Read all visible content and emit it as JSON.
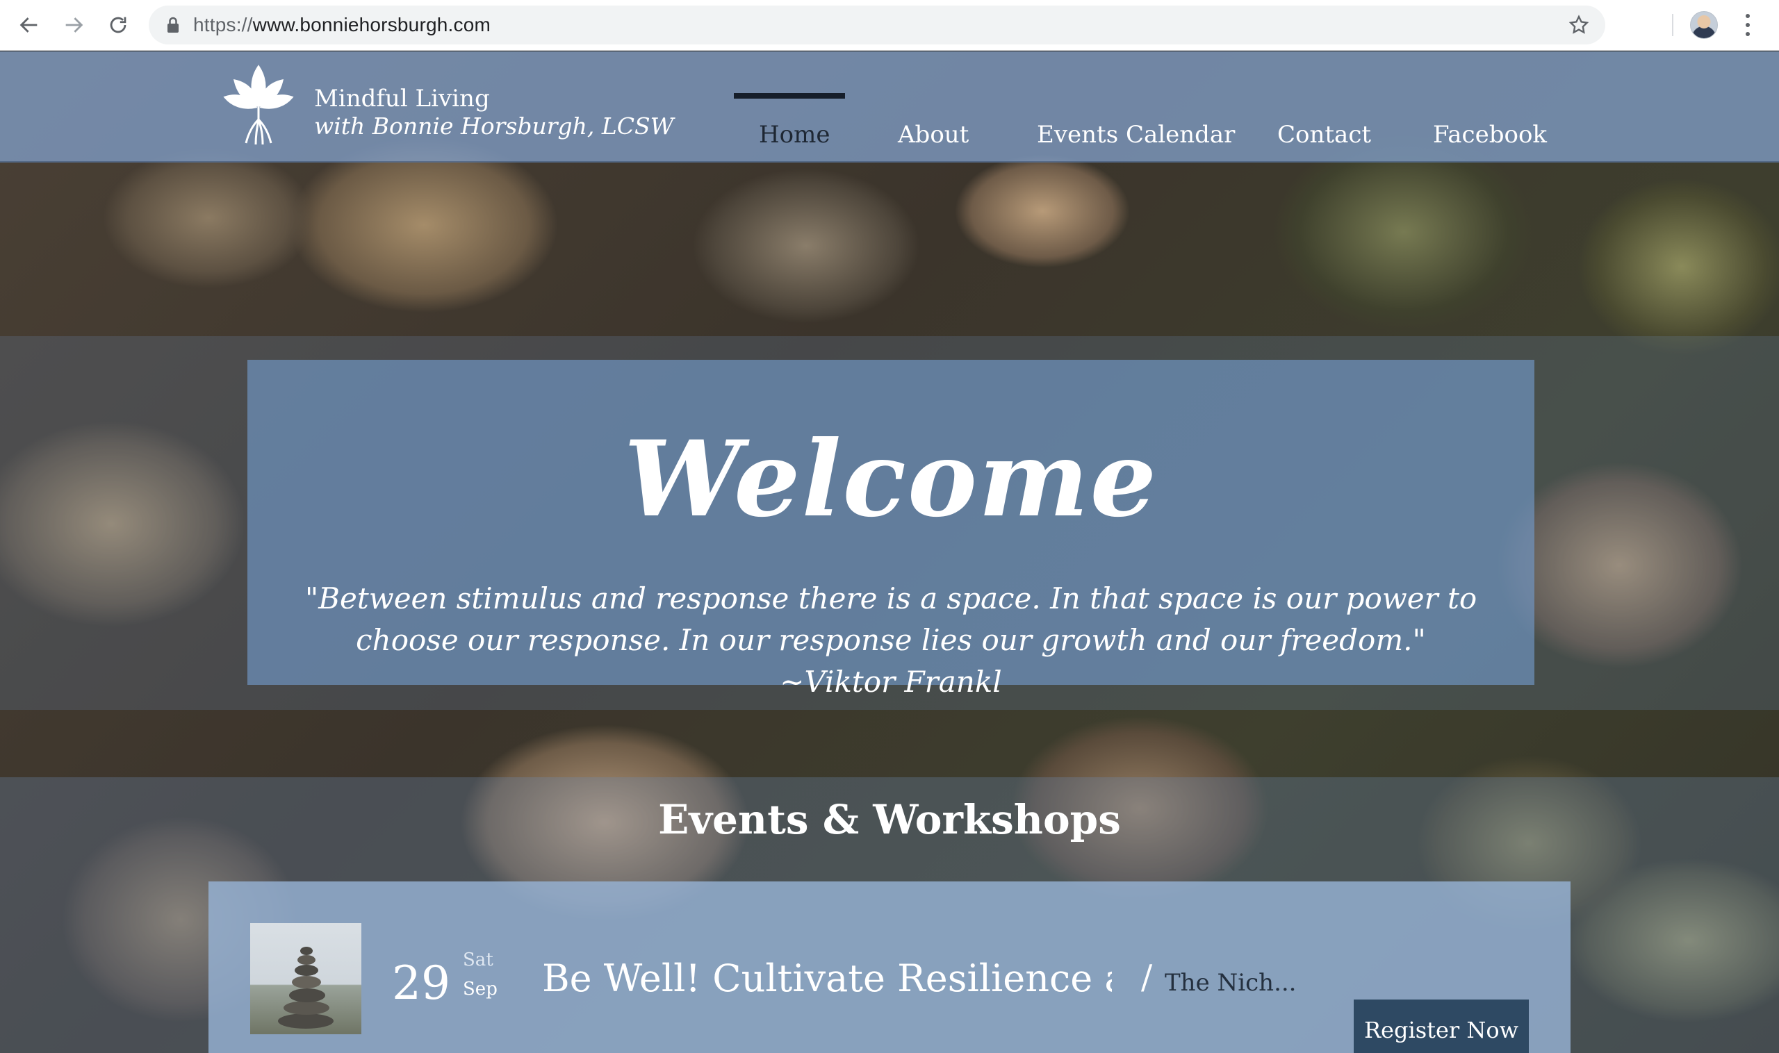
{
  "browser": {
    "url_scheme": "https://",
    "url_host": "www.bonniehorsburgh.com",
    "icons": [
      "back-arrow-icon",
      "forward-arrow-icon",
      "reload-icon",
      "lock-icon",
      "star-icon",
      "profile-avatar",
      "more-vert-icon"
    ]
  },
  "site": {
    "brand_line1": "Mindful Living",
    "brand_line2": "with Bonnie Horsburgh, LCSW",
    "logo_icon": "lotus-roots-icon",
    "nav": [
      {
        "label": "Home",
        "active": true
      },
      {
        "label": "About",
        "active": false
      },
      {
        "label": "Events Calendar",
        "active": false
      },
      {
        "label": "Contact",
        "active": false
      },
      {
        "label": "Facebook",
        "active": false
      }
    ]
  },
  "welcome": {
    "title": "Welcome",
    "quote": "\"Between stimulus and response there is a space.  In that space is our power to choose our response.  In our response lies our growth and our freedom.\"  ~Viktor Frankl"
  },
  "events": {
    "heading": "Events & Workshops",
    "items": [
      {
        "day": "29",
        "weekday": "Sat",
        "month": "Sep",
        "name": "Be Well! Cultivate Resilience and ...",
        "separator": "/",
        "venue": "The Nich...",
        "button": "Register Now"
      }
    ]
  },
  "colors": {
    "header_overlay": "#809ec6",
    "welcome_box": "#7096c4",
    "button_bg": "#2e4963",
    "active_nav": "#1e2733"
  }
}
